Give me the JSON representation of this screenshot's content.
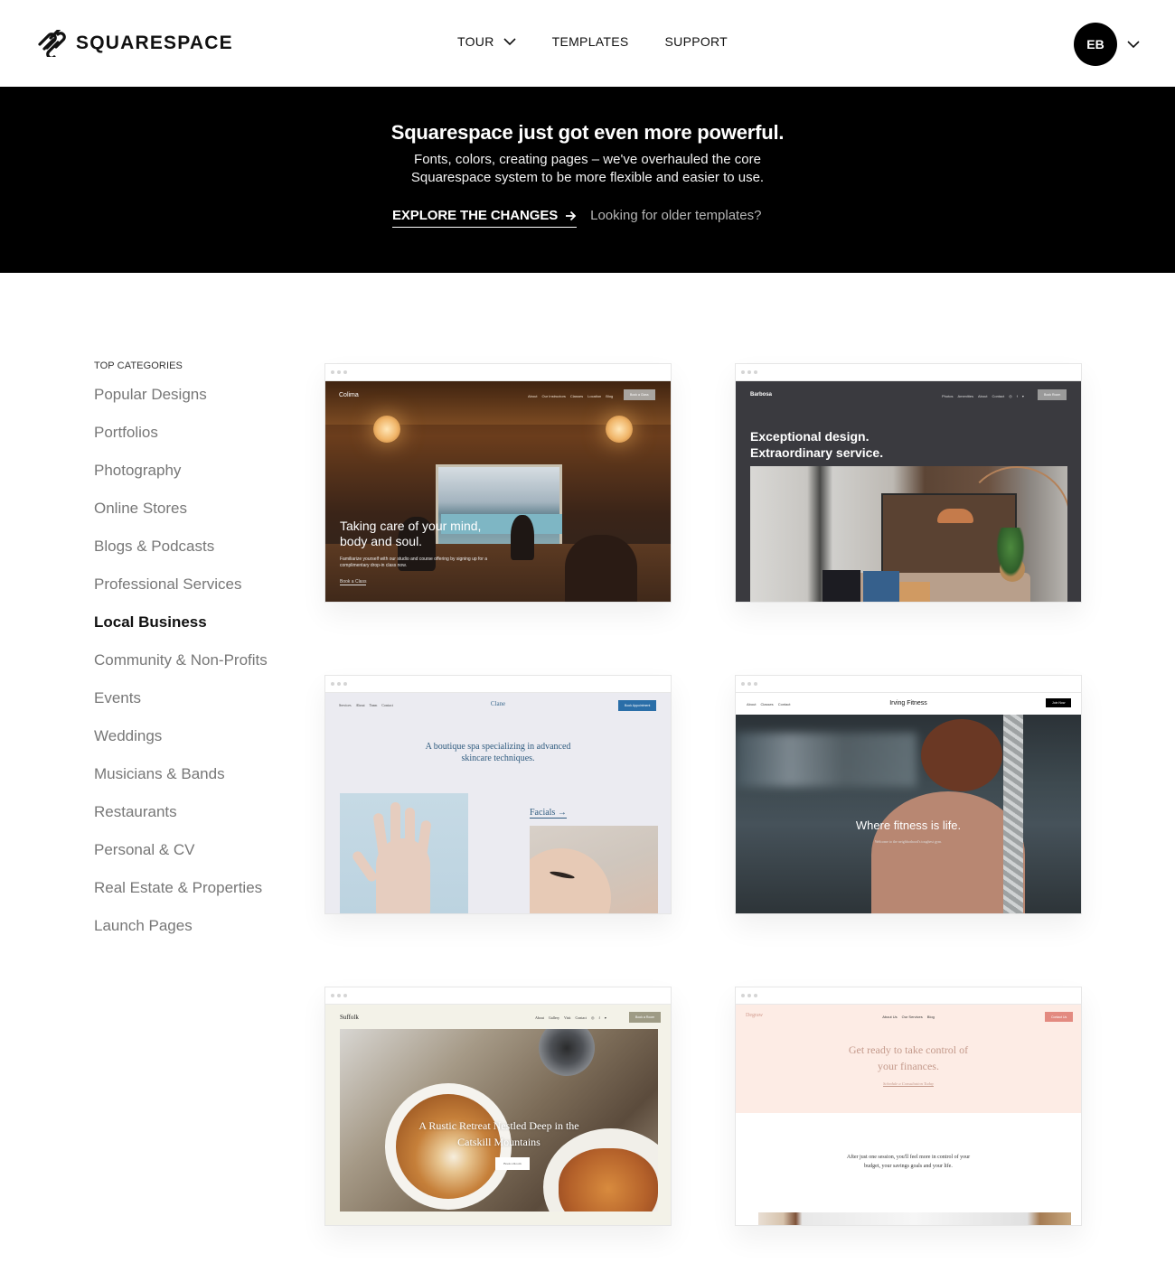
{
  "header": {
    "brand": "SQUARESPACE",
    "nav": [
      {
        "label": "TOUR",
        "has_dropdown": true
      },
      {
        "label": "TEMPLATES",
        "has_dropdown": false
      },
      {
        "label": "SUPPORT",
        "has_dropdown": false
      }
    ],
    "account": {
      "initials": "EB",
      "icon": "chevron-down-icon"
    }
  },
  "banner": {
    "title": "Squarespace just got even more powerful.",
    "description_line1": "Fonts, colors, creating pages – we've overhauled the core",
    "description_line2": "Squarespace system to be more flexible and easier to use.",
    "primary_link": "EXPLORE THE CHANGES",
    "primary_link_icon": "arrow-right-icon",
    "secondary_link": "Looking for older templates?"
  },
  "sidebar": {
    "heading": "TOP CATEGORIES",
    "items": [
      {
        "label": "Popular Designs",
        "active": false
      },
      {
        "label": "Portfolios",
        "active": false
      },
      {
        "label": "Photography",
        "active": false
      },
      {
        "label": "Online Stores",
        "active": false
      },
      {
        "label": "Blogs & Podcasts",
        "active": false
      },
      {
        "label": "Professional Services",
        "active": false
      },
      {
        "label": "Local Business",
        "active": true
      },
      {
        "label": "Community & Non-Profits",
        "active": false
      },
      {
        "label": "Events",
        "active": false
      },
      {
        "label": "Weddings",
        "active": false
      },
      {
        "label": "Musicians & Bands",
        "active": false
      },
      {
        "label": "Restaurants",
        "active": false
      },
      {
        "label": "Personal & CV",
        "active": false
      },
      {
        "label": "Real Estate & Properties",
        "active": false
      },
      {
        "label": "Launch Pages",
        "active": false
      }
    ]
  },
  "templates": [
    {
      "name": "Colima",
      "nav_links": [
        "About",
        "Our Instructors",
        "Classes",
        "Location",
        "Blog"
      ],
      "cta": "Book a Class",
      "hero_title_line1": "Taking care of your mind,",
      "hero_title_line2": "body and soul.",
      "hero_sub": "Familiarize yourself with our studio and course offering by signing up for a complimentary drop-in class now.",
      "hero_link": "Book a Class"
    },
    {
      "name": "Barbosa",
      "nav_links": [
        "Photos",
        "Amenities",
        "About",
        "Contact"
      ],
      "social_icons": [
        "instagram-icon",
        "facebook-icon",
        "twitter-icon"
      ],
      "cta": "Book Room",
      "hero_title_line1": "Exceptional design.",
      "hero_title_line2": "Extraordinary service."
    },
    {
      "name": "Clane",
      "nav_links": [
        "Services",
        "About",
        "Team",
        "Contact"
      ],
      "cta": "Book Appointment",
      "hero_title_line1": "A boutique spa specializing in advanced",
      "hero_title_line2": "skincare techniques.",
      "section_link": "Facials →"
    },
    {
      "name": "Irving Fitness",
      "nav_links": [
        "About",
        "Classes",
        "Contact"
      ],
      "cta": "Join Now",
      "hero_title": "Where fitness is life.",
      "hero_sub": "Welcome to the neighborhood's toughest gym."
    },
    {
      "name": "Suffolk",
      "nav_links": [
        "About",
        "Gallery",
        "Visit",
        "Contact"
      ],
      "social_icons": [
        "instagram-icon",
        "facebook-icon",
        "twitter-icon"
      ],
      "cta": "Book a Room",
      "hero_title_line1": "A Rustic Retreat Nestled Deep in the",
      "hero_title_line2": "Catskill Mountains",
      "hero_button": "Book a Room"
    },
    {
      "name": "Degraw",
      "nav_links": [
        "About Us",
        "Our Services",
        "Blog"
      ],
      "cta": "Contact Us",
      "hero_title_line1": "Get ready to take control of",
      "hero_title_line2": "your finances.",
      "hero_link": "Schedule a Consultation Today",
      "body_line1": "After just one session, you'll feel more in control of your",
      "body_line2": "budget, your savings goals and your life."
    }
  ],
  "colors": {
    "banner_bg": "#000000",
    "text_primary": "#111111",
    "sidebar_inactive": "#777777",
    "secondary_link": "#b5b5b5"
  }
}
